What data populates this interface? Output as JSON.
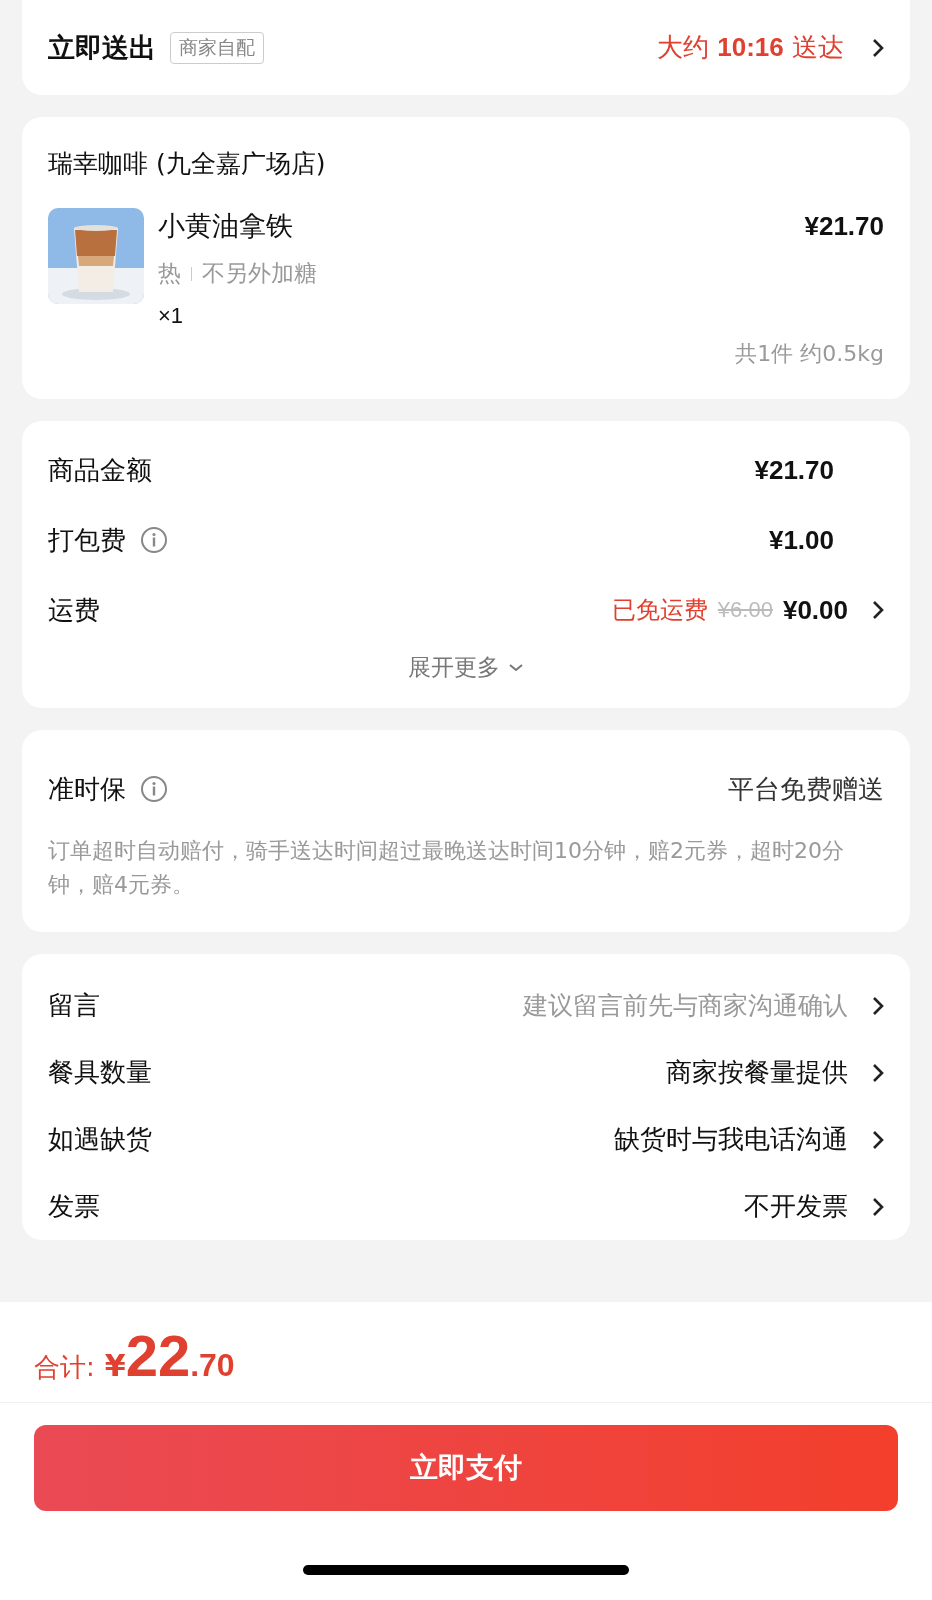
{
  "delivery": {
    "title": "立即送出",
    "tag": "商家自配",
    "eta": "大约 **10:16** 送达"
  },
  "store": {
    "name": "瑞幸咖啡 (九全嘉广场店)",
    "items": [
      {
        "name": "小黄油拿铁",
        "specs": [
          "热",
          "不另外加糖"
        ],
        "quantity": "×1",
        "price": "¥21.70"
      }
    ],
    "summary": "共1件 约0.5kg"
  },
  "fees": {
    "rows": [
      {
        "kind": "plain",
        "label": "商品金额",
        "value": "¥21.70"
      },
      {
        "kind": "info",
        "label": "打包费",
        "value": "¥1.00"
      },
      {
        "kind": "discount",
        "label": "运费",
        "note": "已免运费",
        "original": "¥6.00",
        "value": "¥0.00"
      }
    ],
    "expand": "展开更多"
  },
  "guarantee": {
    "title": "准时保",
    "value": "平台免费赠送",
    "description": "订单超时自动赔付，骑手送达时间超过最晚送达时间10分钟，赔2元券，超时20分钟，赔4元券。"
  },
  "options": [
    {
      "label": "留言",
      "placeholder": "建议留言前先与商家沟通确认"
    },
    {
      "label": "餐具数量",
      "value": "商家按餐量提供"
    },
    {
      "label": "如遇缺货",
      "value": "缺货时与我电话沟通"
    },
    {
      "label": "发票",
      "value": "不开发票"
    }
  ],
  "footer": {
    "total_label": "合计:",
    "currency": "¥",
    "total_integer": "22",
    "total_decimal": ".70",
    "pay_button": "立即支付"
  }
}
